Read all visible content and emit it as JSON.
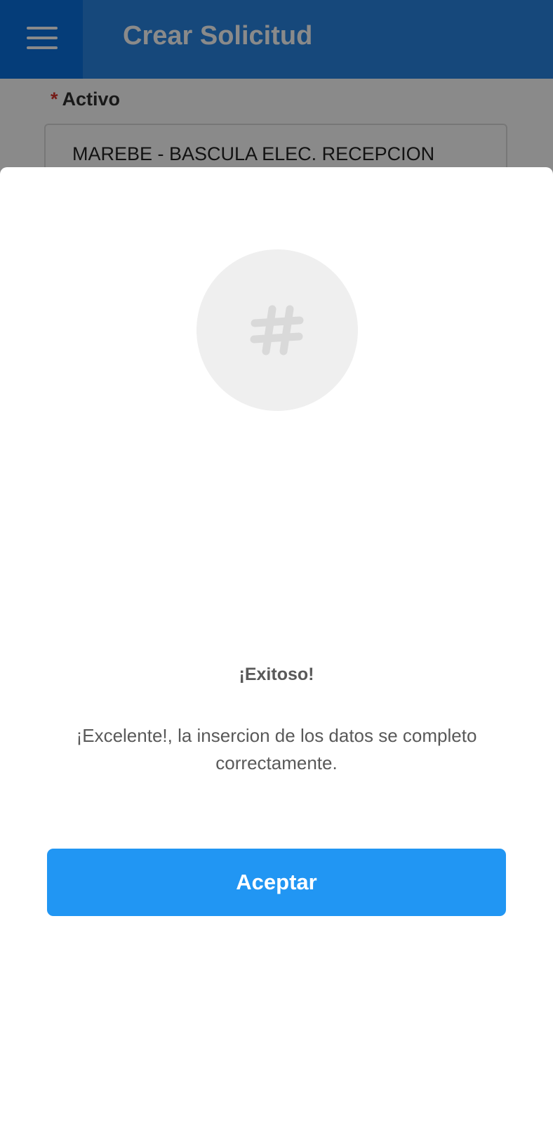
{
  "header": {
    "title": "Crear Solicitud",
    "menu_icon": "hamburger-menu-icon",
    "background_color": "#2a85e3",
    "menu_zone_color": "#0a72e0"
  },
  "form": {
    "required_marker": "*",
    "asset_label": "Activo",
    "asset_value": "MAREBE - BASCULA ELEC. RECEPCION"
  },
  "dialog": {
    "icon": "hash-icon",
    "title": "¡Exitoso!",
    "message": "¡Excelente!, la insercion de los datos se completo correctamente.",
    "accept_label": "Aceptar",
    "button_color": "#2196f3"
  }
}
